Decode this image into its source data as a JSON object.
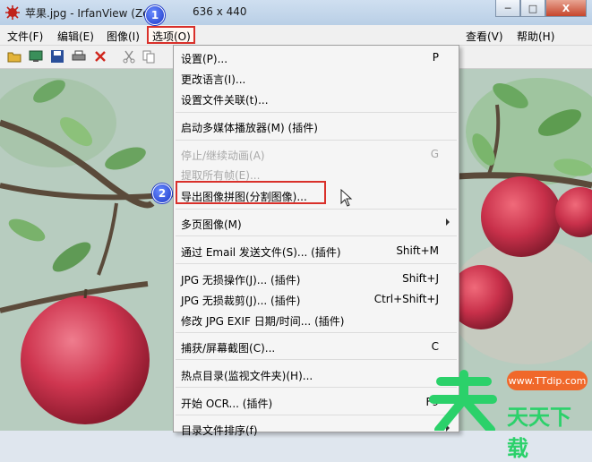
{
  "window": {
    "title": "苹果.jpg - IrfanView (Zo",
    "title_dims": "636 x 440",
    "buttons": {
      "minimize": "─",
      "maximize": "□",
      "close": "X"
    }
  },
  "menubar": [
    {
      "label": "文件(F)"
    },
    {
      "label": "编辑(E)"
    },
    {
      "label": "图像(I)"
    },
    {
      "label": "选项(O)"
    },
    {
      "label": "查看(V)"
    },
    {
      "label": "帮助(H)"
    }
  ],
  "annotations": {
    "badge1": "1",
    "badge2": "2"
  },
  "options_menu": {
    "items": [
      {
        "label": "设置(P)...",
        "shortcut": "P"
      },
      {
        "label": "更改语言(I)...",
        "shortcut": ""
      },
      {
        "label": "设置文件关联(t)...",
        "shortcut": ""
      },
      {
        "label": "启动多媒体播放器(M) (插件)",
        "shortcut": ""
      },
      {
        "label": "停止/继续动画(A)",
        "shortcut": "G"
      },
      {
        "label": "提取所有帧(E)...",
        "shortcut": ""
      },
      {
        "label": "导出图像拼图(分割图像)...",
        "shortcut": ""
      },
      {
        "label": "多页图像(M)",
        "shortcut": ""
      },
      {
        "label": "通过 Email 发送文件(S)... (插件)",
        "shortcut": "Shift+M"
      },
      {
        "label": "JPG 无损操作(J)... (插件)",
        "shortcut": "Shift+J"
      },
      {
        "label": "JPG 无损裁剪(J)... (插件)",
        "shortcut": "Ctrl+Shift+J"
      },
      {
        "label": "修改 JPG EXIF 日期/时间... (插件)",
        "shortcut": ""
      },
      {
        "label": "捕获/屏幕截图(C)...",
        "shortcut": "C"
      },
      {
        "label": "热点目录(监视文件夹)(H)...",
        "shortcut": ""
      },
      {
        "label": "开始 OCR... (插件)",
        "shortcut": "F9"
      },
      {
        "label": "目录文件排序(f)",
        "shortcut": ""
      }
    ]
  },
  "watermark": {
    "text": "天天下载",
    "url": "www.TTdip.com"
  },
  "colors": {
    "accent_red": "#d9302a",
    "badge_blue": "#1d38c8",
    "watermark_green": "#2bd16a"
  }
}
